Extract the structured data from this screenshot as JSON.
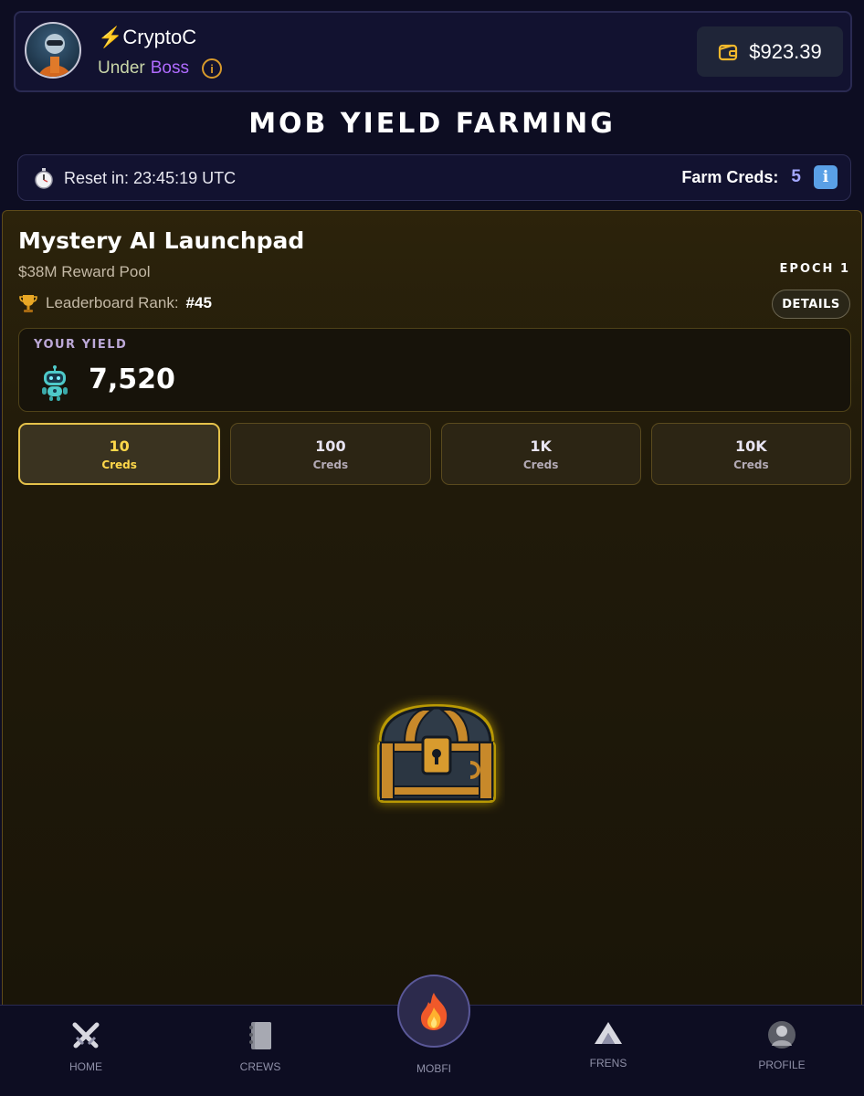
{
  "header": {
    "username": "⚡CryptoC",
    "rank_prefix": "Under",
    "rank_name": "Boss",
    "wallet_balance": "$923.39"
  },
  "page_title": "MOB YIELD FARMING",
  "reset": {
    "label": "Reset in: 23:45:19 UTC"
  },
  "farm": {
    "creds_label": "Farm Creds:",
    "creds_value": "5"
  },
  "card": {
    "title": "Mystery AI Launchpad",
    "reward_pool": "$38M Reward Pool",
    "epoch": "EPOCH 1",
    "leaderboard_label": "Leaderboard Rank:",
    "leaderboard_value": "#45",
    "details_label": "DETAILS",
    "yield_label": "YOUR YIELD",
    "yield_value": "7,520"
  },
  "cred_options": [
    {
      "amount": "10",
      "unit": "Creds"
    },
    {
      "amount": "100",
      "unit": "Creds"
    },
    {
      "amount": "1K",
      "unit": "Creds"
    },
    {
      "amount": "10K",
      "unit": "Creds"
    }
  ],
  "nav": {
    "home": "HOME",
    "crews": "CREWS",
    "mobfi": "MOBFI",
    "frens": "FRENS",
    "profile": "PROFILE"
  },
  "colors": {
    "accent_gold": "#ffd84a",
    "rank_purple": "#b06bff",
    "creds_blue": "#a3a7ff"
  },
  "icons": {
    "wallet": "wallet-icon",
    "stopwatch": "stopwatch-icon",
    "info": "info-icon",
    "trophy": "trophy-icon",
    "robot": "robot-icon",
    "chest": "treasure-chest-icon",
    "fire": "fire-icon"
  }
}
